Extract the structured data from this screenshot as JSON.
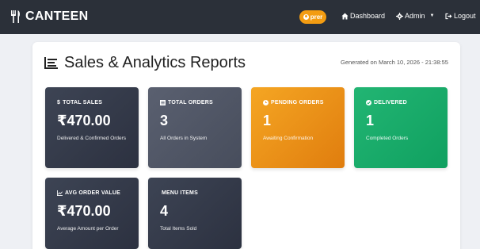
{
  "navbar": {
    "brand": "CANTEEN",
    "user": "prer",
    "links": {
      "dashboard": "Dashboard",
      "admin": "Admin",
      "logout": "Logout"
    }
  },
  "page": {
    "title": "Sales & Analytics Reports",
    "generated": "Generated on March 10, 2026 - 21:38:55"
  },
  "stats": [
    {
      "label": "TOTAL SALES",
      "value": "₹470.00",
      "sub": "Delivered & Confirmed Orders",
      "icon": "dollar-icon",
      "color": "#353b4a"
    },
    {
      "label": "TOTAL ORDERS",
      "value": "3",
      "sub": "All Orders in System",
      "icon": "list-icon",
      "color": "#515768"
    },
    {
      "label": "PENDING ORDERS",
      "value": "1",
      "sub": "Awaiting Confirmation",
      "icon": "clock-icon",
      "color": "#ec931a"
    },
    {
      "label": "DELIVERED",
      "value": "1",
      "sub": "Completed Orders",
      "icon": "check-circle-icon",
      "color": "#18ab69"
    },
    {
      "label": "AVG ORDER VALUE",
      "value": "₹470.00",
      "sub": "Average Amount per Order",
      "icon": "chart-line-icon",
      "color": "#353b4a"
    },
    {
      "label": "MENU ITEMS",
      "value": "4",
      "sub": "Total Items Sold",
      "icon": "",
      "color": "#353b4a"
    }
  ]
}
